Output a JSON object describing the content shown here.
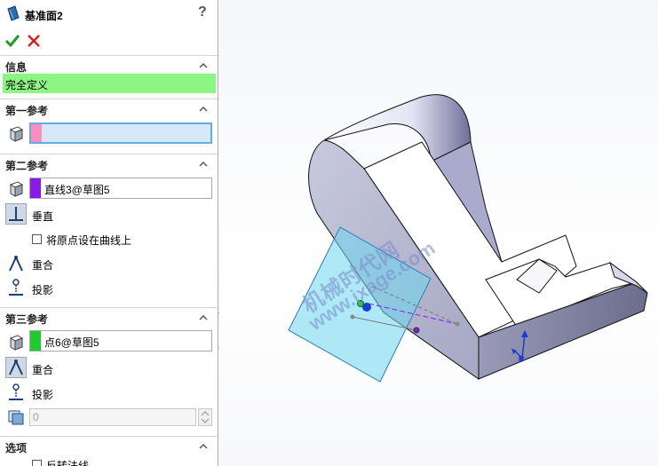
{
  "panel": {
    "title": "基准面2",
    "help": "?",
    "info": {
      "header": "信息",
      "status": "完全定义",
      "status_color": "#8cf584"
    },
    "first_ref": {
      "header": "第一参考",
      "selection": "",
      "swatch_color": "#f88fc0"
    },
    "second_ref": {
      "header": "第二参考",
      "selection": "直线3@草图5",
      "swatch_color": "#8a1be6",
      "options": {
        "perpendicular": "垂直",
        "origin_on_curve": "将原点设在曲线上",
        "coincident": "重合",
        "project": "投影"
      }
    },
    "third_ref": {
      "header": "第三参考",
      "selection": "点6@草图5",
      "swatch_color": "#1ecc2e",
      "options": {
        "coincident": "重合",
        "project": "投影"
      },
      "offset_value": "0"
    },
    "options_section": {
      "header": "选项",
      "flip_normal": "反转法线"
    }
  },
  "viewport": {
    "watermark_cn": "机械时代网",
    "watermark_url": "www.jxage.com"
  }
}
